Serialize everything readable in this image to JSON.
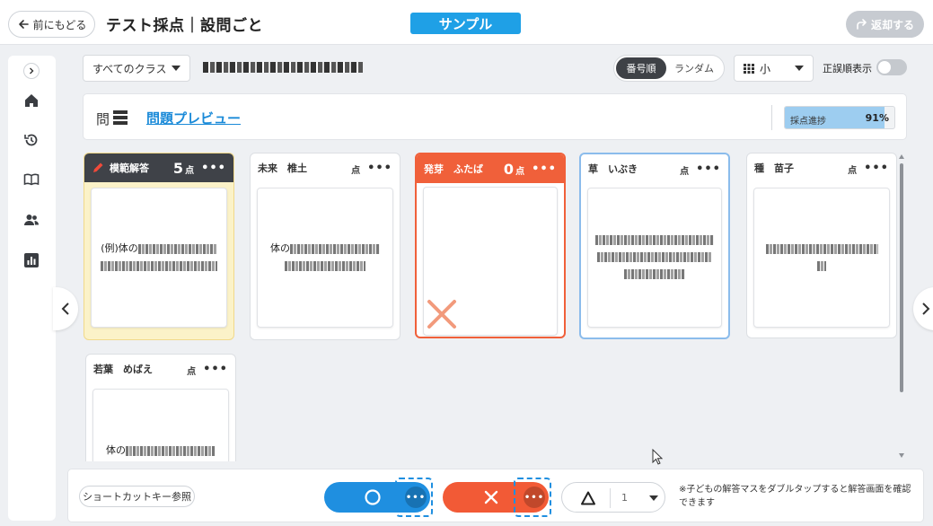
{
  "header": {
    "back_label": "前にもどる",
    "title": "テスト採点｜設問ごと",
    "badge": "サンプル",
    "return_label": "返却する"
  },
  "filters": {
    "class_select": "すべてのクラス",
    "sort_number": "番号順",
    "sort_random": "ランダム",
    "size_select": "小",
    "correct_toggle_label": "正誤順表示"
  },
  "question": {
    "label": "問",
    "preview_link": "問題プレビュー",
    "progress_label": "採点進捗",
    "progress_pct_text": "91%",
    "progress_value": 0.91
  },
  "cards": [
    {
      "name": "模範解答",
      "score": "5",
      "unit": "点",
      "more": "•••",
      "text_start": "(例)体の"
    },
    {
      "name": "未来　椎土",
      "score": "",
      "unit": "点",
      "more": "•••",
      "text_start": "体の"
    },
    {
      "name": "発芽　ふたば",
      "score": "0",
      "unit": "点",
      "more": "•••",
      "text_start": ""
    },
    {
      "name": "草　いぶき",
      "score": "",
      "unit": "点",
      "more": "•••",
      "text_start": ""
    },
    {
      "name": "種　苗子",
      "score": "",
      "unit": "点",
      "more": "•••",
      "text_start": ""
    },
    {
      "name": "若葉　めばえ",
      "score": "",
      "unit": "点",
      "more": "•••",
      "text_start": "体の"
    }
  ],
  "toolbar": {
    "shortcut_label": "ショートカットキー参照",
    "more_dots": "•••",
    "partial_value": "1",
    "hint_text": "※子どもの解答マスをダブルタップすると解答画面を確認できます"
  },
  "colors": {
    "accent_blue": "#1fa0e6",
    "correct_blue": "#1f8fe0",
    "incorrect_orange": "#f25a36",
    "model_yellow": "#fbf2c8"
  }
}
